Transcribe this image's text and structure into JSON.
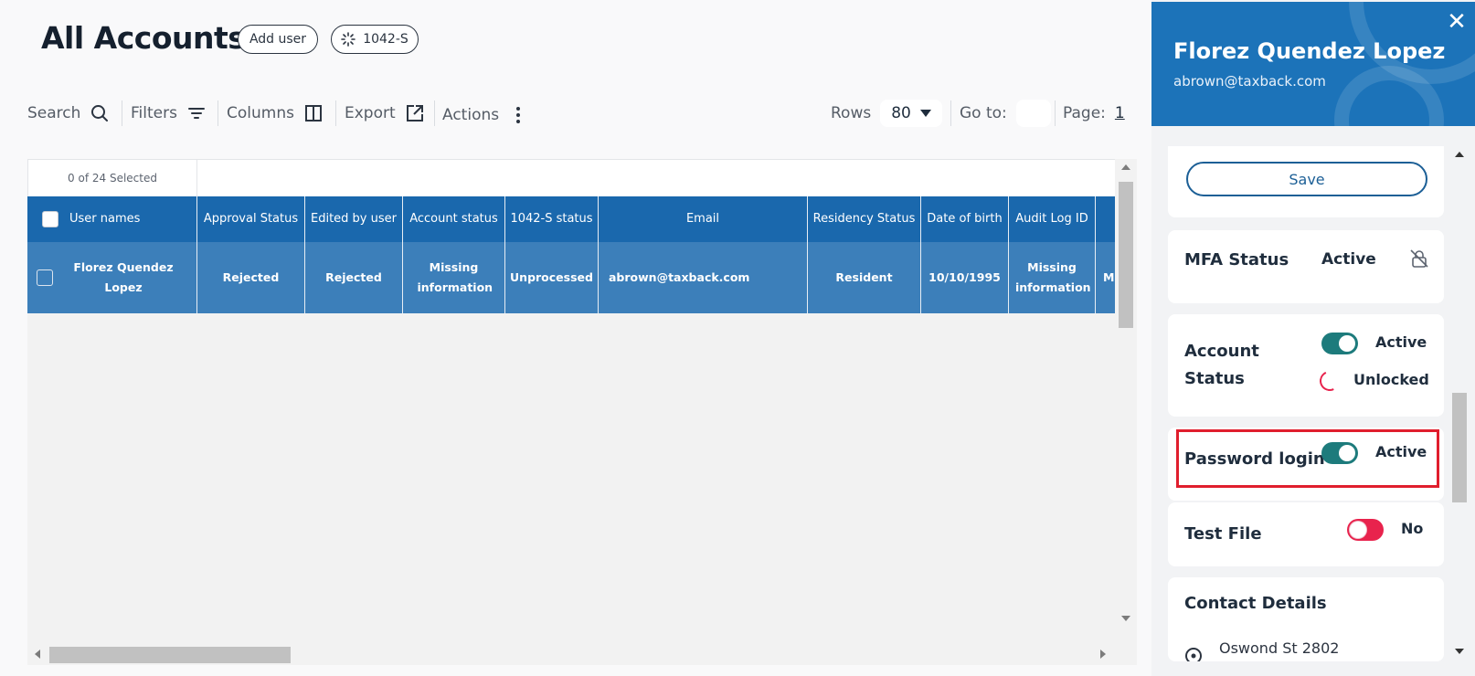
{
  "page": {
    "title": "All Accounts",
    "add_user_label": "Add user",
    "form_1042_label": "1042-S"
  },
  "toolbar": {
    "search_label": "Search",
    "filters_label": "Filters",
    "columns_label": "Columns",
    "export_label": "Export",
    "actions_label": "Actions",
    "rows_label": "Rows",
    "rows_value": "80",
    "goto_label": "Go to:",
    "page_label": "Page:",
    "page_value": "1"
  },
  "table": {
    "selected_text": "0 of 24 Selected",
    "columns": [
      "User names",
      "Approval Status",
      "Edited by user",
      "Account status",
      "1042-S status",
      "Email",
      "Residency Status",
      "Date of birth",
      "Audit Log ID",
      "M"
    ],
    "rows": [
      {
        "user_name": "Florez Quendez Lopez",
        "approval_status": "Rejected",
        "edited_by_user": "Rejected",
        "account_status": "Missing information",
        "status_1042": "Unprocessed",
        "email": "abrown@taxback.com",
        "residency_status": "Resident",
        "date_of_birth": "10/10/1995",
        "audit_log_id": "Missing information",
        "next": "Mi"
      }
    ]
  },
  "drawer": {
    "name": "Florez Quendez Lopez",
    "email": "abrown@taxback.com",
    "save_label": "Save",
    "mfa": {
      "label": "MFA Status",
      "value": "Active"
    },
    "account_status": {
      "label_line1": "Account",
      "label_line2": "Status",
      "active_value": "Active",
      "lock_value": "Unlocked"
    },
    "password_login": {
      "label": "Password login",
      "value": "Active"
    },
    "test_file": {
      "label": "Test File",
      "value": "No"
    },
    "contact": {
      "title": "Contact Details",
      "address_line1": "Oswond St 2802"
    }
  },
  "colors": {
    "header_blue": "#1c73b9",
    "table_header": "#1a68ad",
    "table_row": "#3c7fba",
    "toggle_on": "#1d7b7c",
    "toggle_off": "#e8234d",
    "highlight": "#e01e2d"
  }
}
